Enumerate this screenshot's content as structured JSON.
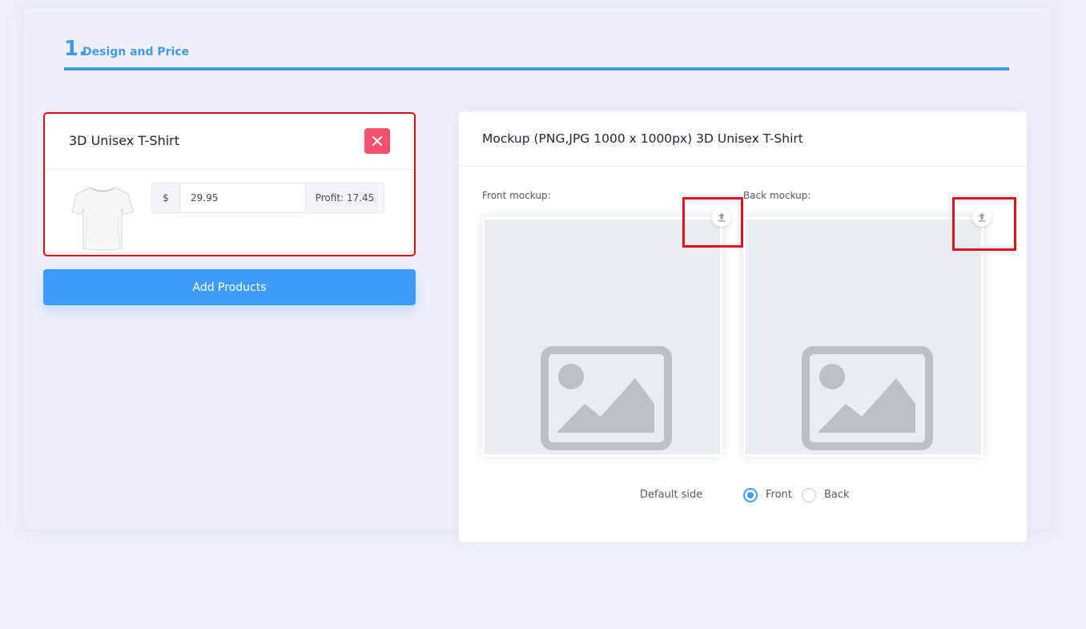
{
  "step": {
    "number": "1.",
    "title": "Design and Price"
  },
  "product": {
    "name": "3D Unisex T-Shirt",
    "currency": "$",
    "price": "29.95",
    "profit": "Profit: 17.45"
  },
  "add_products_label": "Add Products",
  "mockup": {
    "title": "Mockup (PNG,JPG 1000 x 1000px) 3D Unisex T-Shirt",
    "front_label": "Front mockup:",
    "back_label": "Back mockup:",
    "default_side_label": "Default side",
    "options": [
      "Front",
      "Back"
    ],
    "selected": "Front"
  },
  "colors": {
    "accent": "#3d9bf9",
    "danger": "#f4516c",
    "highlight": "#e0121b"
  }
}
